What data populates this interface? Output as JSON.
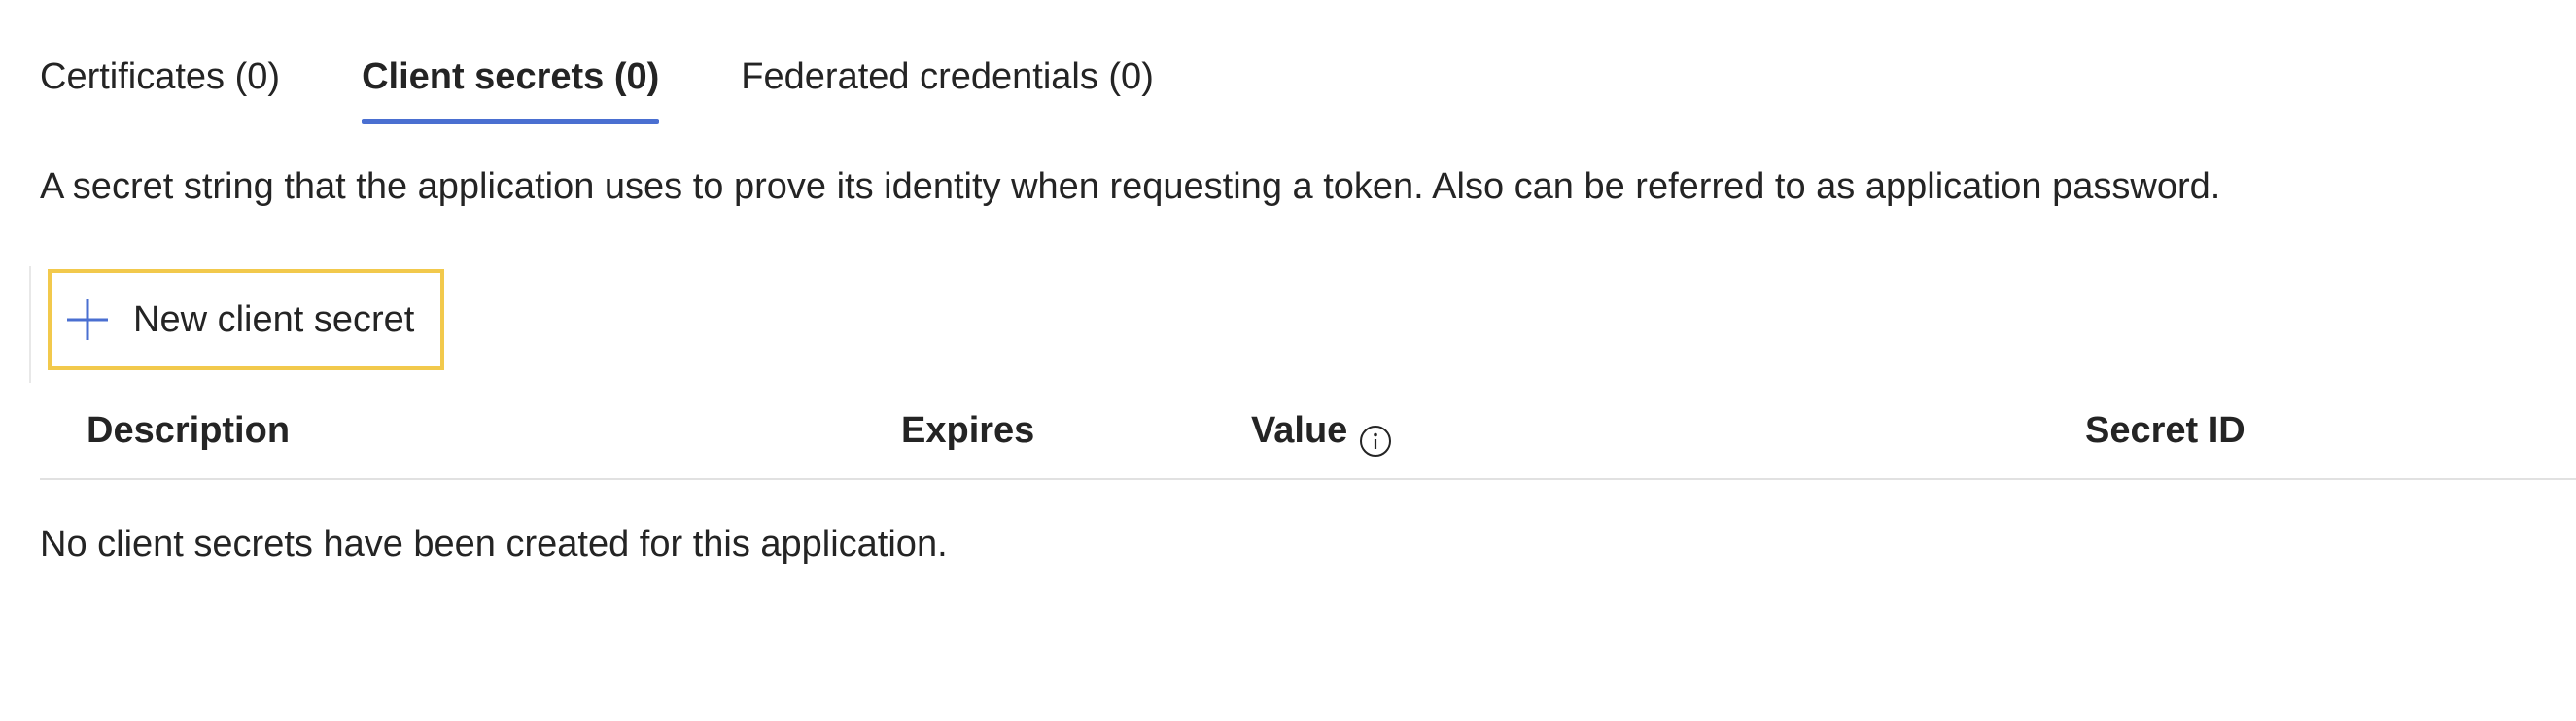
{
  "tabs": [
    {
      "label": "Certificates (0)",
      "active": false
    },
    {
      "label": "Client secrets (0)",
      "active": true
    },
    {
      "label": "Federated credentials (0)",
      "active": false
    }
  ],
  "description": "A secret string that the application uses to prove its identity when requesting a token. Also can be referred to as application password.",
  "toolbar": {
    "new_secret_label": "New client secret",
    "new_secret_icon": "plus-icon",
    "highlight_color": "#f2c94c",
    "accent_color": "#4a6fd1"
  },
  "table": {
    "columns": [
      {
        "label": "Description"
      },
      {
        "label": "Expires"
      },
      {
        "label": "Value",
        "icon": "info-icon"
      },
      {
        "label": "Secret ID"
      }
    ],
    "empty_message": "No client secrets have been created for this application."
  }
}
